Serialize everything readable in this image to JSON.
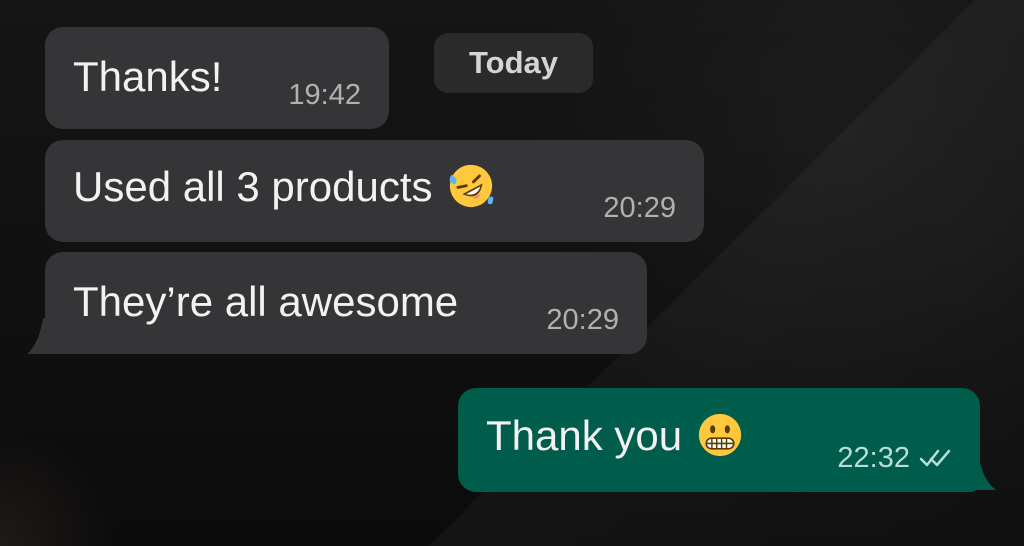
{
  "chat": {
    "date_chip": "Today",
    "messages": [
      {
        "direction": "incoming",
        "text": "Thanks!",
        "time": "19:42"
      },
      {
        "direction": "incoming",
        "text": "Used all 3 products",
        "emoji": "rolling-on-floor-laughing-emoji",
        "time": "20:29"
      },
      {
        "direction": "incoming",
        "text": "They’re all awesome",
        "time": "20:29"
      },
      {
        "direction": "outgoing",
        "text": "Thank you",
        "emoji": "grimacing-face-emoji",
        "time": "22:32",
        "status_icon": "double-check-icon"
      }
    ]
  },
  "colors": {
    "background": "#0e0e0e",
    "incoming_bubble": "#353537",
    "outgoing_bubble": "#005c4b",
    "timestamp_incoming": "#b1b1b1",
    "timestamp_outgoing": "#b9ddd6"
  }
}
